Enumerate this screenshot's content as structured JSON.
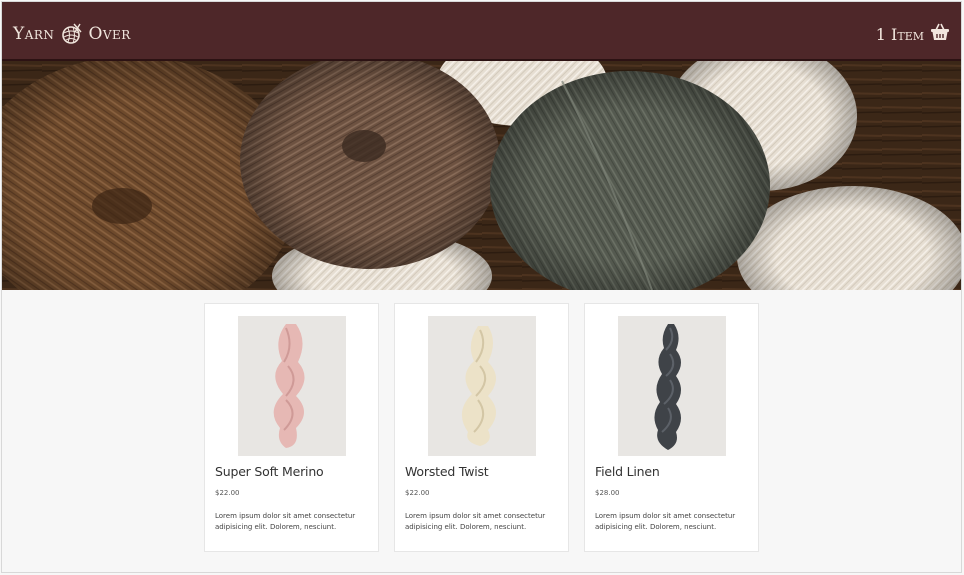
{
  "header": {
    "brand_left": "Yarn",
    "brand_right": "Over",
    "logo_icon": "yarn-ball-icon",
    "cart_label": "1 Item",
    "cart_icon": "basket-icon",
    "colors": {
      "bar": "#4e2729",
      "text": "#f1e6dd"
    }
  },
  "hero": {
    "image": "yarn-balls-photo"
  },
  "products": [
    {
      "name": "Super Soft Merino",
      "price": "$22.00",
      "description": "Lorem ipsum dolor sit amet consectetur adipisicing elit. Dolorem, nesciunt.",
      "skein_color": "#e6b8b4"
    },
    {
      "name": "Worsted Twist",
      "price": "$22.00",
      "description": "Lorem ipsum dolor sit amet consectetur adipisicing elit. Dolorem, nesciunt.",
      "skein_color": "#ece2c8"
    },
    {
      "name": "Field Linen",
      "price": "$28.00",
      "description": "Lorem ipsum dolor sit amet consectetur adipisicing elit. Dolorem, nesciunt.",
      "skein_color": "#3f4348"
    }
  ]
}
